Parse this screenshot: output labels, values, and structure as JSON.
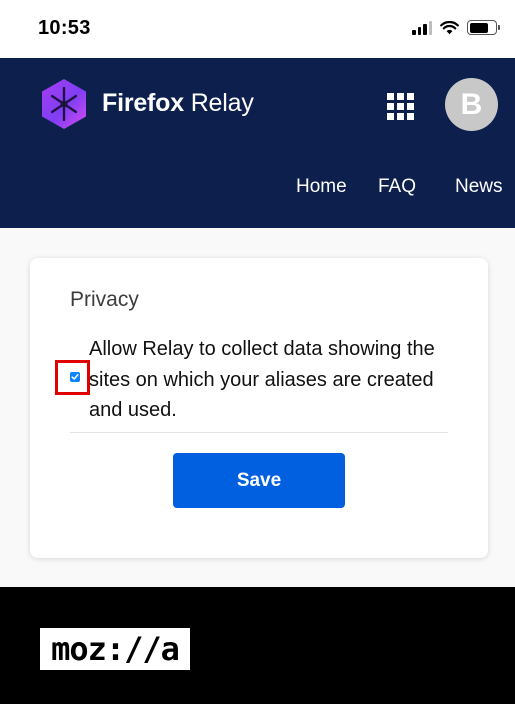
{
  "status_bar": {
    "time": "10:53",
    "icons": [
      "cellular-signal-icon",
      "wifi-icon",
      "battery-icon"
    ]
  },
  "header": {
    "brand_bold": "Firefox",
    "brand_light": " Relay",
    "logo_icon": "firefox-relay-logo-icon",
    "apps_icon": "app-grid-icon",
    "avatar_initial": "B",
    "nav": [
      {
        "label": "Home"
      },
      {
        "label": "FAQ"
      },
      {
        "label": "News"
      }
    ],
    "colors": {
      "background": "#0c1f4d",
      "avatar": "#c8c8c8"
    }
  },
  "privacy_card": {
    "title": "Privacy",
    "checkbox_checked": true,
    "checkbox_label": "Allow Relay to collect data showing the sites on which your aliases are created and used.",
    "save_label": "Save",
    "colors": {
      "button": "#0060df",
      "checkbox": "#0a84ff",
      "highlight": "#e00000"
    }
  },
  "footer": {
    "logo_text": "moz://a"
  }
}
